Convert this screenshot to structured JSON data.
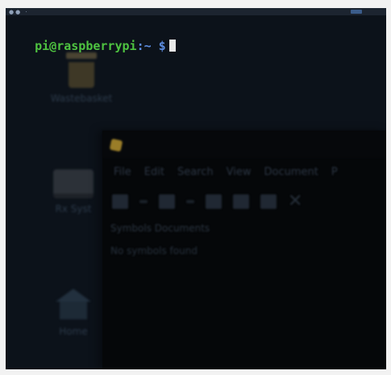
{
  "topbar": {
    "left_glyphs": "●● ·"
  },
  "terminal": {
    "user_host": "pi@raspberrypi",
    "path": ":~ $"
  },
  "desktop": {
    "icons": [
      {
        "label": "Wastebasket",
        "icon": "trash-icon"
      },
      {
        "label": "Rx Syst",
        "icon": "drive-icon"
      },
      {
        "label": "Home",
        "icon": "home-icon"
      }
    ]
  },
  "app": {
    "menu": [
      "File",
      "Edit",
      "Search",
      "View",
      "Document",
      "P"
    ],
    "symbols_title": "Symbols  Documents",
    "symbols_empty": "No symbols found"
  },
  "colors": {
    "screen_bg": "#0c121a",
    "prompt_user": "#4ec240",
    "prompt_path": "#5c8ce0"
  }
}
